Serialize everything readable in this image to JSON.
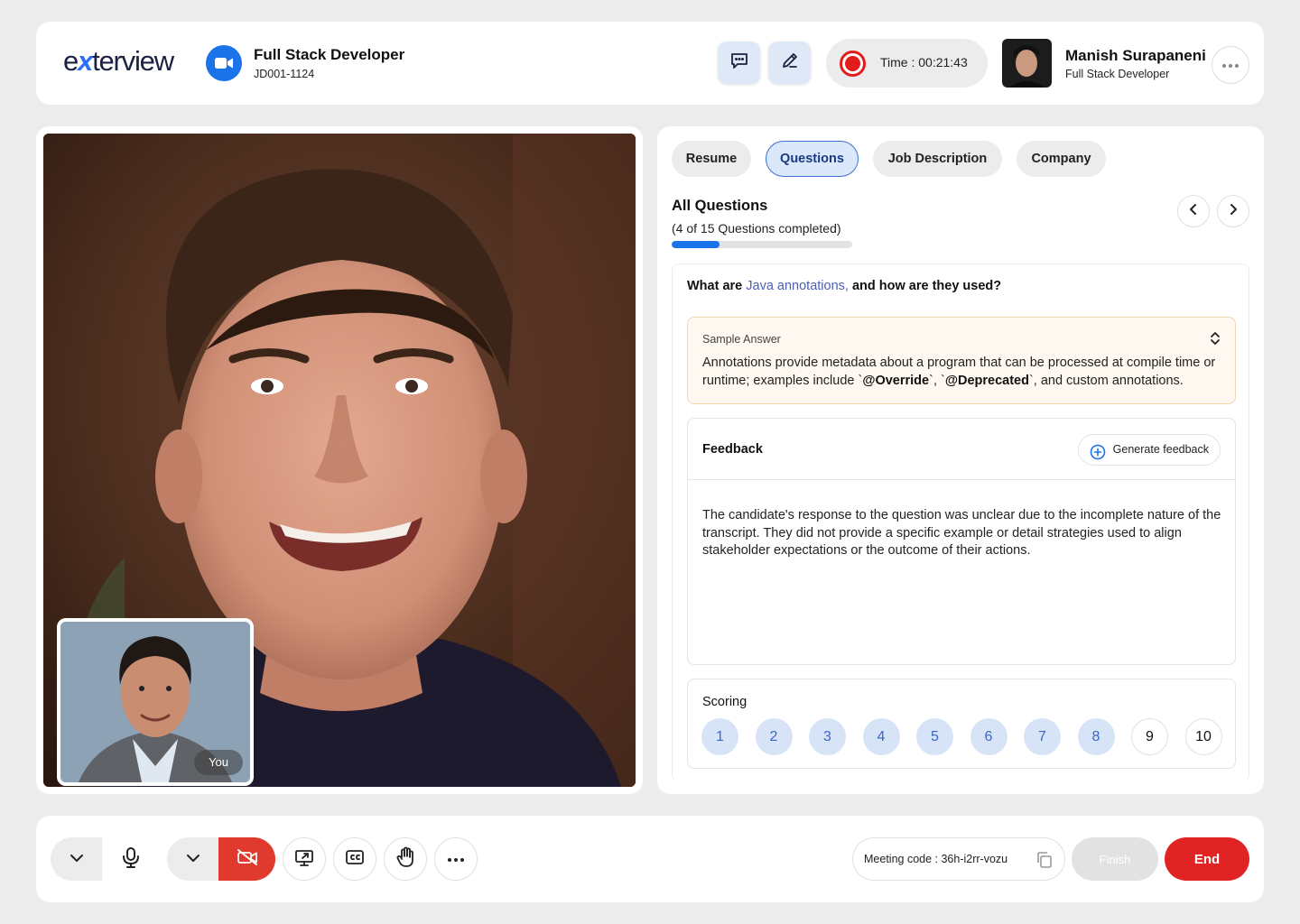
{
  "brand": {
    "logo_pre": "e",
    "logo_x": "x",
    "logo_post": "terview",
    "accent": "#1a73e8"
  },
  "job": {
    "title": "Full Stack Developer",
    "code": "JD001-1124",
    "icon": "video-camera-icon"
  },
  "header": {
    "chat_icon": "chat-icon",
    "edit_icon": "pencil-icon",
    "timer_label": "Time : 00:21:43",
    "record_color": "#e21b1b",
    "more_icon": "more-horizontal-icon"
  },
  "user": {
    "name": "Manish Surapaneni",
    "role": "Full Stack Developer"
  },
  "video": {
    "self_label": "You"
  },
  "tabs": [
    {
      "label": "Resume",
      "active": false
    },
    {
      "label": "Questions",
      "active": true
    },
    {
      "label": "Job Description",
      "active": false
    },
    {
      "label": "Company",
      "active": false
    }
  ],
  "questions": {
    "title": "All Questions",
    "progress_text": "(4 of 15 Questions completed)",
    "completed": 4,
    "total": 15,
    "question_pre": "What are ",
    "question_highlight": "Java annotations,",
    "question_post": " and how are they used?",
    "sample_label": "Sample Answer",
    "sample_pre": "Annotations provide metadata about a program that can be processed at compile time or runtime; examples include `",
    "sample_b1": "@Override",
    "sample_mid": "`, `",
    "sample_b2": "@Deprecated",
    "sample_post": "`, and custom annotations."
  },
  "feedback": {
    "title": "Feedback",
    "generate_label": "Generate feedback",
    "text": "The candidate's response to the question was unclear due to the incomplete nature of the transcript. They did not provide a specific example or detail strategies used to align stakeholder expectations or the outcome of their actions."
  },
  "scoring": {
    "title": "Scoring",
    "scores": [
      "1",
      "2",
      "3",
      "4",
      "5",
      "6",
      "7",
      "8",
      "9",
      "10"
    ],
    "highlighted_up_to": 8
  },
  "controls": {
    "meeting_label": "Meeting code : 36h-i2rr-vozu",
    "finish_label": "Finish",
    "end_label": "End",
    "end_color": "#e02424",
    "camera_off_color": "#e03a2f"
  }
}
